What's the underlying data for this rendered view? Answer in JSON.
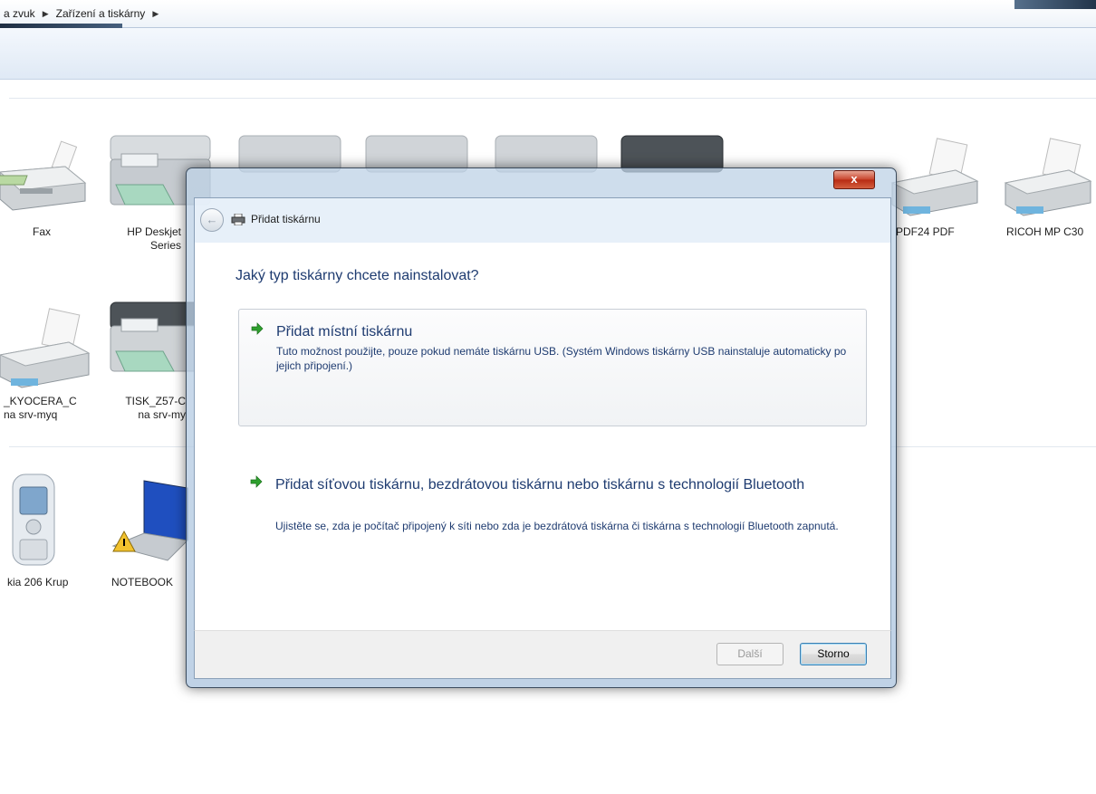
{
  "window": {
    "breadcrumbs": [
      "a zvuk",
      "Zařízení a tiskárny"
    ]
  },
  "devices": [
    {
      "label": "Fax"
    },
    {
      "label": "HP Deskjet\nSeries"
    },
    {
      "label": "PDF24 PDF"
    },
    {
      "label": "RICOH MP C30"
    },
    {
      "label": "_KYOCERA_C\nna srv-myq"
    },
    {
      "label": "TISK_Z57-C\nna srv-my"
    },
    {
      "label": "kia 206 Krup"
    },
    {
      "label": "NOTEBOOK"
    }
  ],
  "dialog": {
    "close_label": "x",
    "title": "Přidat tiskárnu",
    "question": "Jaký typ tiskárny chcete nainstalovat?",
    "options": [
      {
        "title": "Přidat místní tiskárnu",
        "description": "Tuto možnost použijte, pouze pokud nemáte tiskárnu USB. (Systém Windows tiskárny USB nainstaluje automaticky po jejich připojení.)"
      },
      {
        "title": "Přidat síťovou tiskárnu, bezdrátovou tiskárnu nebo tiskárnu s technologií Bluetooth",
        "description": "Ujistěte se, zda je počítač připojený k síti nebo zda je bezdrátová tiskárna či tiskárna s technologií Bluetooth zapnutá."
      }
    ],
    "buttons": {
      "next": "Další",
      "cancel": "Storno"
    }
  },
  "colors": {
    "heading_blue": "#1e3b70",
    "arrow_green": "#2ea02e",
    "close_red": "#c8432b"
  }
}
